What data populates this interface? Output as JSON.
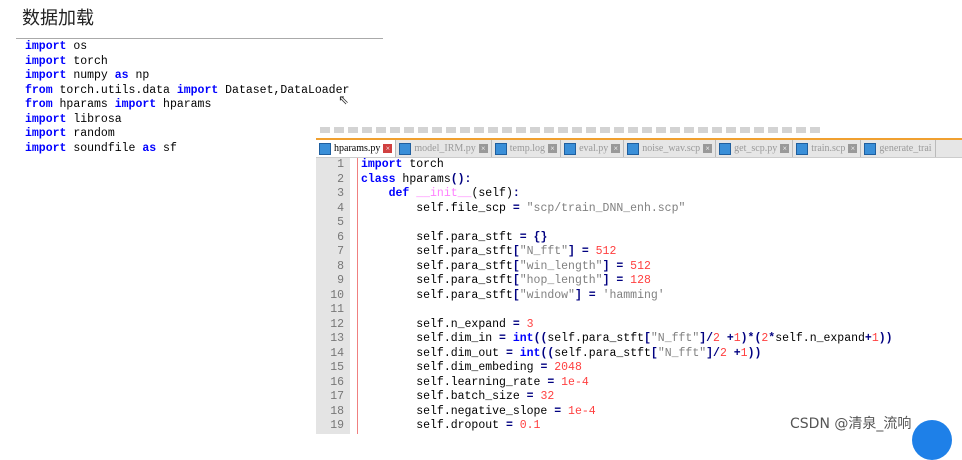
{
  "title": "数据加载",
  "left_code": [
    [
      [
        "import ",
        "kw"
      ],
      [
        "os",
        "def"
      ]
    ],
    [
      [
        "import ",
        "kw"
      ],
      [
        "torch",
        "def"
      ]
    ],
    [
      [
        "import ",
        "kw"
      ],
      [
        "numpy ",
        "def"
      ],
      [
        "as ",
        "kw"
      ],
      [
        "np",
        "def"
      ]
    ],
    [
      [
        "from ",
        "kw"
      ],
      [
        "torch.utils.data ",
        "def"
      ],
      [
        "import ",
        "kw"
      ],
      [
        "Dataset,DataLoader",
        "def"
      ]
    ],
    [
      [
        "from ",
        "kw"
      ],
      [
        "hparams ",
        "def"
      ],
      [
        "import ",
        "kw"
      ],
      [
        "hparams",
        "def"
      ]
    ],
    [
      [
        "import ",
        "kw"
      ],
      [
        "librosa",
        "def"
      ]
    ],
    [
      [
        "import ",
        "kw"
      ],
      [
        "random",
        "def"
      ]
    ],
    [
      [
        "import ",
        "kw"
      ],
      [
        "soundfile ",
        "def"
      ],
      [
        "as ",
        "kw"
      ],
      [
        "sf",
        "def"
      ]
    ]
  ],
  "tabs": [
    "hparams.py",
    "model_IRM.py",
    "temp.log",
    "eval.py",
    "noise_wav.scp",
    "get_scp.py",
    "train.scp",
    "generate_trai"
  ],
  "line_numbers": [
    "1",
    "2",
    "3",
    "4",
    "5",
    "6",
    "7",
    "8",
    "9",
    "10",
    "11",
    "12",
    "13",
    "14",
    "15",
    "16",
    "17",
    "18",
    "19"
  ],
  "editor_code": [
    [
      [
        "import ",
        "kw"
      ],
      [
        "torch",
        "def"
      ]
    ],
    [
      [
        "class ",
        "kw"
      ],
      [
        "hparams",
        "def"
      ],
      [
        "():",
        "op"
      ]
    ],
    [
      [
        "    def ",
        "kw"
      ],
      [
        "__init__",
        "mag"
      ],
      [
        "(self)",
        "def"
      ],
      [
        ":",
        "op"
      ]
    ],
    [
      [
        "        self.file_scp ",
        "def"
      ],
      [
        "= ",
        "op"
      ],
      [
        "\"scp/train_DNN_enh.scp\"",
        "str"
      ]
    ],
    [
      [
        "",
        ""
      ]
    ],
    [
      [
        "        self.para_stft ",
        "def"
      ],
      [
        "= {}",
        "op"
      ]
    ],
    [
      [
        "        self.para_stft",
        "def"
      ],
      [
        "[",
        "op"
      ],
      [
        "\"N_fft\"",
        "str"
      ],
      [
        "] = ",
        "op"
      ],
      [
        "512",
        "num"
      ]
    ],
    [
      [
        "        self.para_stft",
        "def"
      ],
      [
        "[",
        "op"
      ],
      [
        "\"win_length\"",
        "str"
      ],
      [
        "] = ",
        "op"
      ],
      [
        "512",
        "num"
      ]
    ],
    [
      [
        "        self.para_stft",
        "def"
      ],
      [
        "[",
        "op"
      ],
      [
        "\"hop_length\"",
        "str"
      ],
      [
        "] = ",
        "op"
      ],
      [
        "128",
        "num"
      ]
    ],
    [
      [
        "        self.para_stft",
        "def"
      ],
      [
        "[",
        "op"
      ],
      [
        "\"window\"",
        "str"
      ],
      [
        "] = ",
        "op"
      ],
      [
        "'hamming'",
        "str"
      ]
    ],
    [
      [
        "",
        ""
      ]
    ],
    [
      [
        "        self.n_expand ",
        "def"
      ],
      [
        "= ",
        "op"
      ],
      [
        "3",
        "num"
      ]
    ],
    [
      [
        "        self.dim_in ",
        "def"
      ],
      [
        "= ",
        "op"
      ],
      [
        "int",
        "kw"
      ],
      [
        "((",
        "op"
      ],
      [
        "self.para_stft",
        "def"
      ],
      [
        "[",
        "op"
      ],
      [
        "\"N_fft\"",
        "str"
      ],
      [
        "]/",
        "op"
      ],
      [
        "2 ",
        "num"
      ],
      [
        "+",
        "op"
      ],
      [
        "1",
        "num"
      ],
      [
        ")*(",
        "op"
      ],
      [
        "2",
        "num"
      ],
      [
        "*",
        "op"
      ],
      [
        "self.n_expand",
        "def"
      ],
      [
        "+",
        "op"
      ],
      [
        "1",
        "num"
      ],
      [
        "))",
        "op"
      ]
    ],
    [
      [
        "        self.dim_out ",
        "def"
      ],
      [
        "= ",
        "op"
      ],
      [
        "int",
        "kw"
      ],
      [
        "((",
        "op"
      ],
      [
        "self.para_stft",
        "def"
      ],
      [
        "[",
        "op"
      ],
      [
        "\"N_fft\"",
        "str"
      ],
      [
        "]/",
        "op"
      ],
      [
        "2 ",
        "num"
      ],
      [
        "+",
        "op"
      ],
      [
        "1",
        "num"
      ],
      [
        "))",
        "op"
      ]
    ],
    [
      [
        "        self.dim_embeding ",
        "def"
      ],
      [
        "= ",
        "op"
      ],
      [
        "2048",
        "num"
      ]
    ],
    [
      [
        "        self.learning_rate ",
        "def"
      ],
      [
        "= ",
        "op"
      ],
      [
        "1e-4",
        "num"
      ]
    ],
    [
      [
        "        self.batch_size ",
        "def"
      ],
      [
        "= ",
        "op"
      ],
      [
        "32",
        "num"
      ]
    ],
    [
      [
        "        self.negative_slope ",
        "def"
      ],
      [
        "= ",
        "op"
      ],
      [
        "1e-4",
        "num"
      ]
    ],
    [
      [
        "        self.dropout ",
        "def"
      ],
      [
        "= ",
        "op"
      ],
      [
        "0.1",
        "num"
      ]
    ]
  ],
  "watermark": "CSDN @清泉_流响"
}
